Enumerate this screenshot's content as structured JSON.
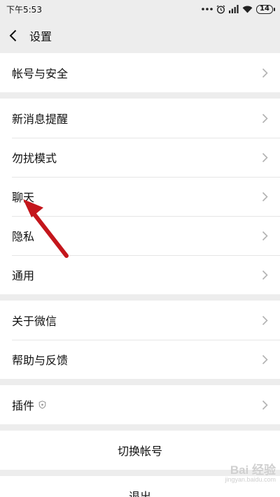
{
  "status_bar": {
    "time": "下午5:53",
    "battery": "14"
  },
  "nav": {
    "title": "设置"
  },
  "groups": [
    [
      "帐号与安全"
    ],
    [
      "新消息提醒",
      "勿扰模式",
      "聊天",
      "隐私",
      "通用"
    ],
    [
      "关于微信",
      "帮助与反馈"
    ],
    [
      "插件"
    ]
  ],
  "actions": {
    "switch_account": "切换帐号",
    "logout": "退出"
  },
  "watermark": {
    "brand": "Bai 经验",
    "url": "jingyan.baidu.com"
  },
  "colors": {
    "background": "#ededed",
    "arrow": "#c4161c"
  }
}
